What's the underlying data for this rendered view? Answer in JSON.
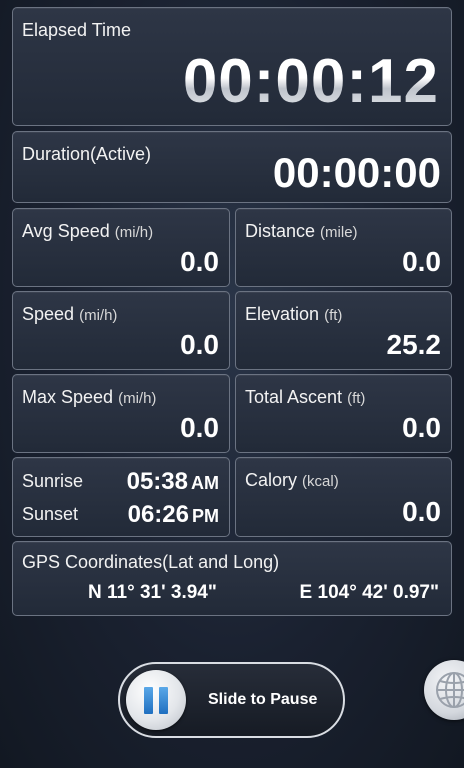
{
  "elapsed": {
    "label": "Elapsed Time",
    "value": "00:00:12"
  },
  "duration": {
    "label": "Duration(Active)",
    "value": "00:00:00"
  },
  "avg_speed": {
    "label": "Avg Speed",
    "unit": "(mi/h)",
    "value": "0.0"
  },
  "distance": {
    "label": "Distance",
    "unit": "(mile)",
    "value": "0.0"
  },
  "speed": {
    "label": "Speed",
    "unit": "(mi/h)",
    "value": "0.0"
  },
  "elevation": {
    "label": "Elevation",
    "unit": "(ft)",
    "value": "25.2"
  },
  "max_speed": {
    "label": "Max Speed",
    "unit": "(mi/h)",
    "value": "0.0"
  },
  "total_ascent": {
    "label": "Total Ascent",
    "unit": "(ft)",
    "value": "0.0"
  },
  "sun": {
    "sunrise_label": "Sunrise",
    "sunrise_time": "05:38",
    "sunrise_ampm": "AM",
    "sunset_label": "Sunset",
    "sunset_time": "06:26",
    "sunset_ampm": "PM"
  },
  "calory": {
    "label": "Calory",
    "unit": "(kcal)",
    "value": "0.0"
  },
  "gps": {
    "label": "GPS Coordinates(Lat and Long)",
    "lat": "N 11° 31' 3.94\"",
    "long": "E 104° 42' 0.97\""
  },
  "controls": {
    "slider_label": "Slide to Pause",
    "slider_icon": "pause-icon",
    "map_icon": "globe-icon"
  },
  "colors": {
    "accent": "#1f6fc0",
    "card_border": "#6b7382",
    "background": "#1a2130"
  }
}
